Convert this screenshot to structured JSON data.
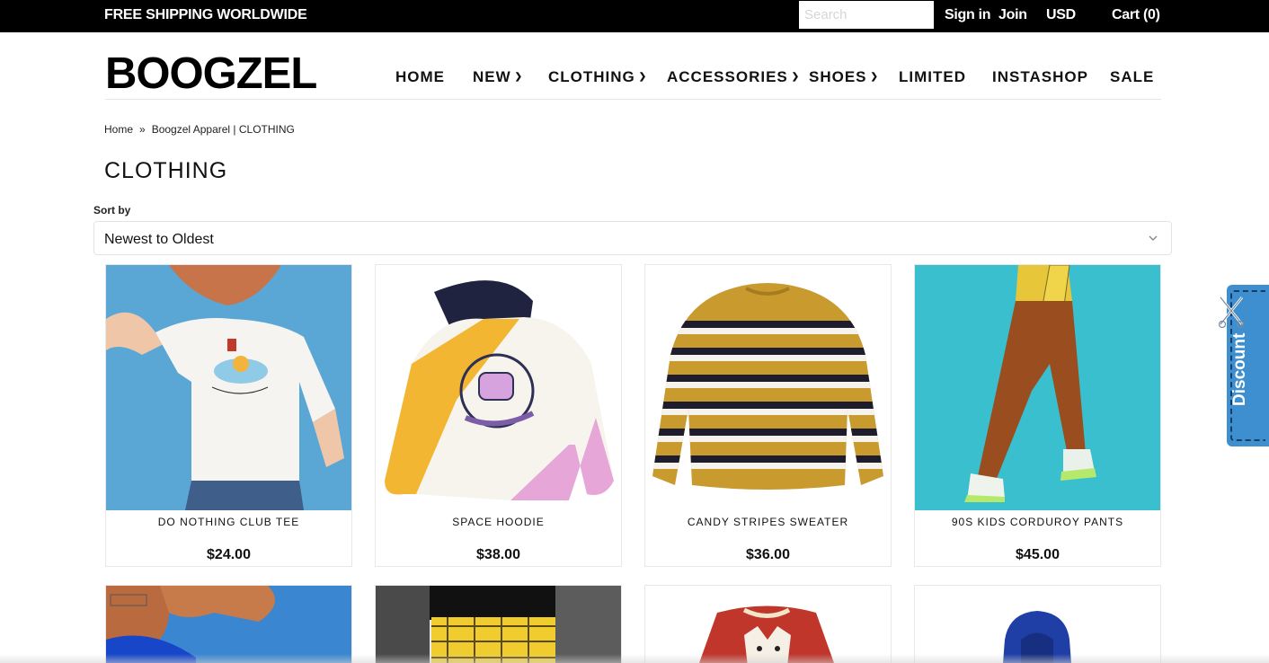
{
  "topbar": {
    "promo": "FREE SHIPPING WORLDWIDE",
    "search_placeholder": "Search",
    "signin": "Sign in",
    "join": "Join",
    "currency": "USD",
    "cart": "Cart (0)"
  },
  "header": {
    "logo": "BOOGZEL",
    "nav": [
      {
        "label": "HOME",
        "dropdown": false
      },
      {
        "label": "NEW",
        "dropdown": true
      },
      {
        "label": "CLOTHING",
        "dropdown": true
      },
      {
        "label": "ACCESSORIES",
        "dropdown": true
      },
      {
        "label": "SHOES",
        "dropdown": true
      },
      {
        "label": "LIMITED",
        "dropdown": false
      },
      {
        "label": "INSTASHOP",
        "dropdown": false
      },
      {
        "label": "SALE",
        "dropdown": false
      }
    ]
  },
  "breadcrumb": {
    "home": "Home",
    "separator": "»",
    "current": "Boogzel Apparel | CLOTHING"
  },
  "page_title": "CLOTHING",
  "sort": {
    "label": "Sort by",
    "selected": "Newest to Oldest"
  },
  "products": [
    {
      "name": "DO NOTHING CLUB TEE",
      "price": "$24.00"
    },
    {
      "name": "SPACE HOODIE",
      "price": "$38.00"
    },
    {
      "name": "CANDY STRIPES SWEATER",
      "price": "$36.00"
    },
    {
      "name": "90S KIDS CORDUROY PANTS",
      "price": "$45.00"
    }
  ],
  "discount_tab": {
    "label": "Discount"
  },
  "colors": {
    "topbar_bg": "#000000",
    "discount_blue": "#3d8fd0",
    "photo_blue": "#5aa7d6",
    "photo_teal": "#39bfcd"
  }
}
